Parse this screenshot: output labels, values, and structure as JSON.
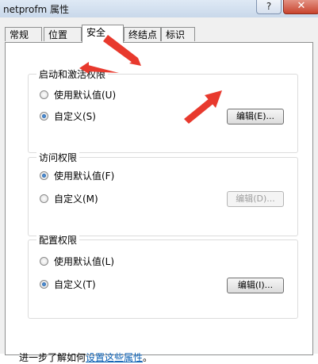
{
  "window": {
    "title": "netprofm 属性",
    "help_label": "?",
    "close_label": "✕"
  },
  "tabs": [
    {
      "label": "常规"
    },
    {
      "label": "位置"
    },
    {
      "label": "安全"
    },
    {
      "label": "终结点"
    },
    {
      "label": "标识"
    }
  ],
  "active_tab": "安全",
  "groups": {
    "launch": {
      "title": "启动和激活权限",
      "options": [
        {
          "label": "使用默认值(U)",
          "selected": false
        },
        {
          "label": "自定义(S)",
          "selected": true
        }
      ],
      "edit_button": "编辑(E)...",
      "edit_enabled": true
    },
    "access": {
      "title": "访问权限",
      "options": [
        {
          "label": "使用默认值(F)",
          "selected": true
        },
        {
          "label": "自定义(M)",
          "selected": false
        }
      ],
      "edit_button": "编辑(D)...",
      "edit_enabled": false
    },
    "config": {
      "title": "配置权限",
      "options": [
        {
          "label": "使用默认值(L)",
          "selected": false
        },
        {
          "label": "自定义(T)",
          "selected": true
        }
      ],
      "edit_button": "编辑(I)...",
      "edit_enabled": true
    }
  },
  "footer": {
    "prefix": "进一步了解如何",
    "link": "设置这些属性",
    "suffix": "。"
  },
  "colors": {
    "annotation_arrow": "#e8392d",
    "link": "#0a5fb3"
  }
}
